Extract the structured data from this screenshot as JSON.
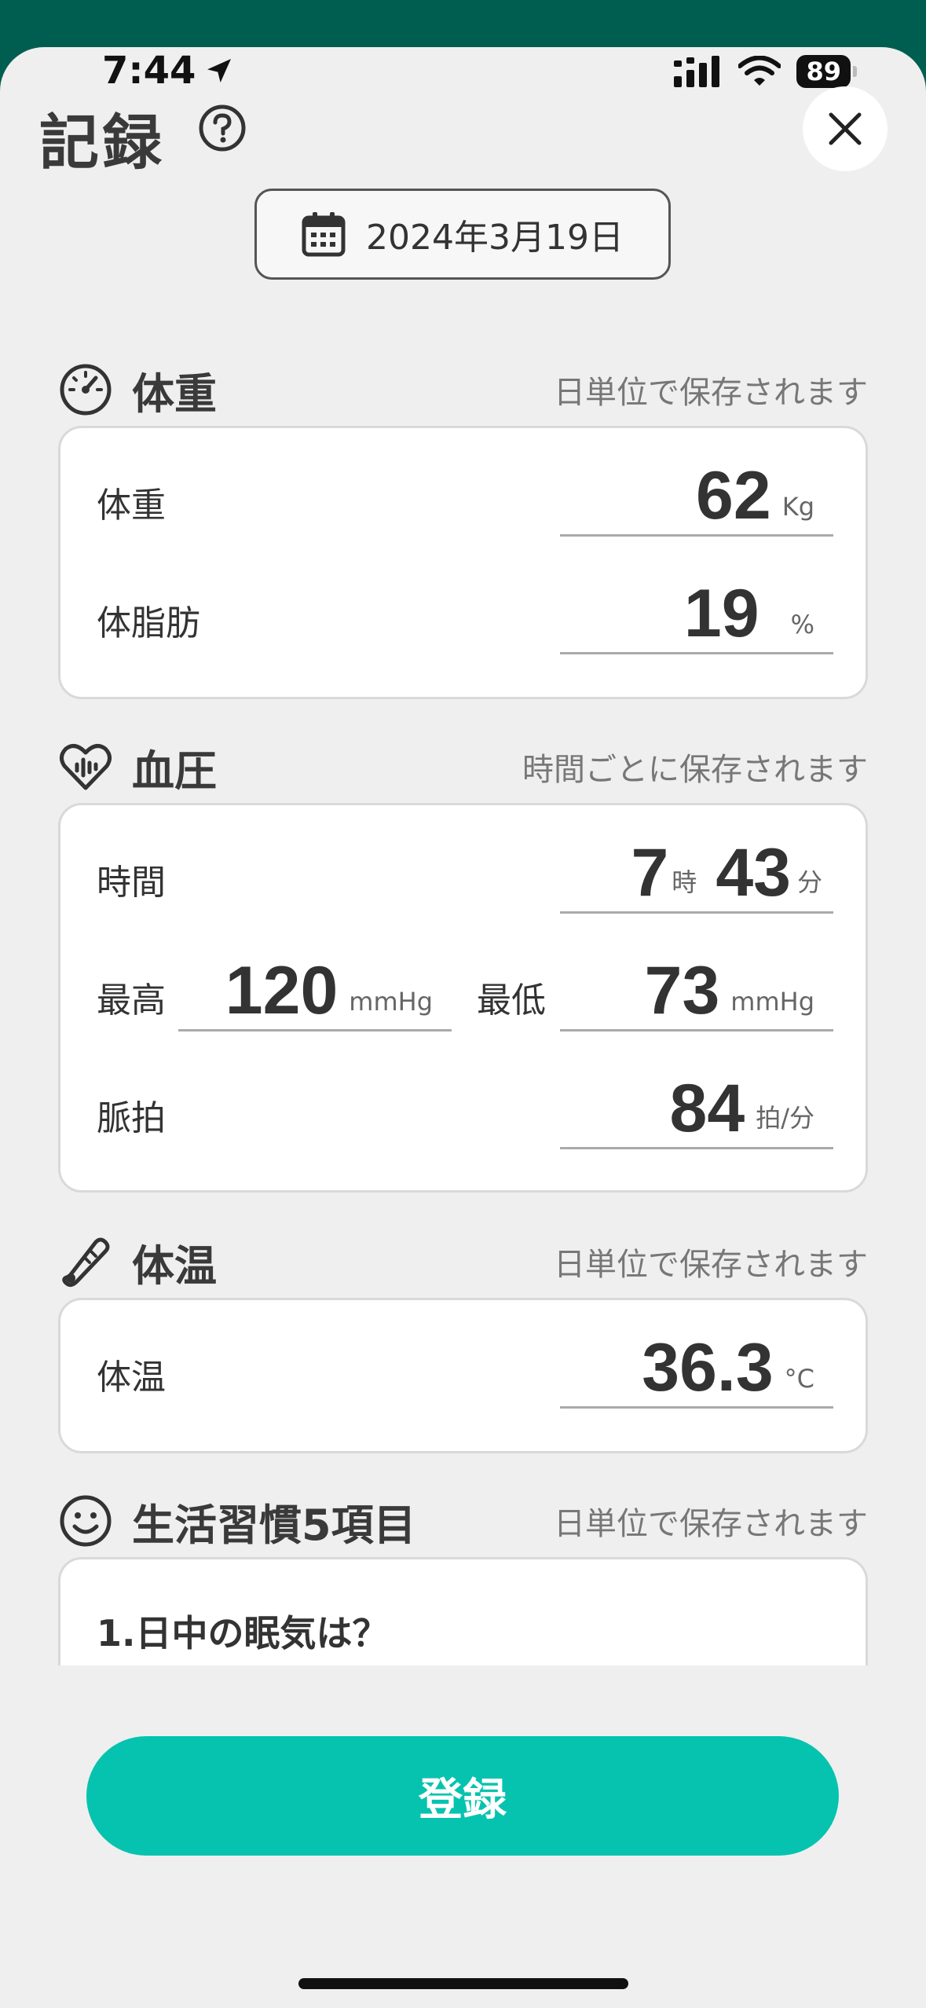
{
  "status_bar": {
    "time": "7:44",
    "battery": "89"
  },
  "header": {
    "title": "記録",
    "date": "2024年3月19日"
  },
  "weight_section": {
    "title": "体重",
    "note": "日単位で保存されます",
    "weight_label": "体重",
    "weight_value": "62",
    "weight_unit": "Kg",
    "fat_label": "体脂肪",
    "fat_value": "19",
    "fat_unit": "%"
  },
  "bp_section": {
    "title": "血圧",
    "note": "時間ごとに保存されます",
    "time_label": "時間",
    "hour_value": "7",
    "hour_unit": "時",
    "minute_value": "43",
    "minute_unit": "分",
    "high_label": "最高",
    "high_value": "120",
    "high_unit": "mmHg",
    "low_label": "最低",
    "low_value": "73",
    "low_unit": "mmHg",
    "pulse_label": "脈拍",
    "pulse_value": "84",
    "pulse_unit": "拍/分"
  },
  "temp_section": {
    "title": "体温",
    "note": "日単位で保存されます",
    "temp_label": "体温",
    "temp_value": "36.3",
    "temp_unit": "°C"
  },
  "habit_section": {
    "title": "生活習慣5項目",
    "note": "日単位で保存されます",
    "question_1": "1.日中の眠気は？"
  },
  "register_button": "登録",
  "colors": {
    "brand_dark": "#005e50",
    "accent": "#06c3af"
  }
}
